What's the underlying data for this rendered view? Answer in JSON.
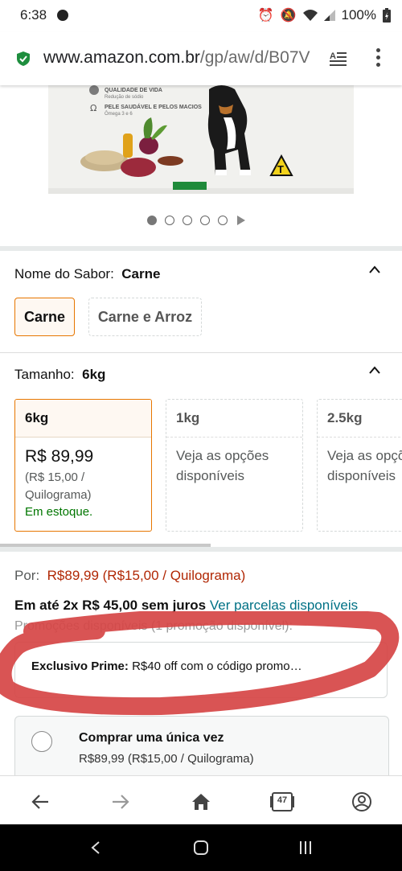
{
  "status_bar": {
    "time": "6:38",
    "battery": "100%"
  },
  "url_bar": {
    "domain": "www.amazon.com.br",
    "path": "/gp/aw/d/B07V"
  },
  "product_image": {
    "features": [
      "QUALIDADE DE VIDA",
      "Redução de sódio",
      "PELE SAUDÁVEL E PELOS MACIOS",
      "Ômega 3 e 6"
    ],
    "badge": "T"
  },
  "flavor": {
    "label": "Nome do Sabor:",
    "selected": "Carne",
    "options": [
      "Carne",
      "Carne e Arroz"
    ]
  },
  "size": {
    "label": "Tamanho:",
    "selected": "6kg",
    "options": [
      {
        "name": "6kg",
        "price": "R$ 89,99",
        "unit_price": "(R$ 15,00 / Quilograma)",
        "stock": "Em estoque."
      },
      {
        "name": "1kg",
        "note": "Veja as opções disponíveis"
      },
      {
        "name": "2.5kg",
        "note": "Veja as opções disponíveis"
      }
    ]
  },
  "price": {
    "label": "Por:",
    "value": "R$89,99 (R$15,00 / Quilograma)"
  },
  "installments": {
    "text": "Em até 2x R$ 45,00 sem juros",
    "link": "Ver parcelas disponíveis"
  },
  "promotions_header": "Promoções disponíveis (1 promoção disponível):",
  "prime_promo": {
    "label": "Exclusivo Prime:",
    "text": "R$40 off com o código promo…"
  },
  "purchase_option": {
    "title": "Comprar uma única vez",
    "price": "R$89,99 (R$15,00 / Quilograma)"
  },
  "bottom_nav": {
    "tabs_count": "47"
  },
  "colors": {
    "price_red": "#B12704",
    "link_teal": "#007185",
    "in_stock_green": "#007600",
    "selected_orange": "#E77600",
    "scribble_red": "#d64545"
  }
}
